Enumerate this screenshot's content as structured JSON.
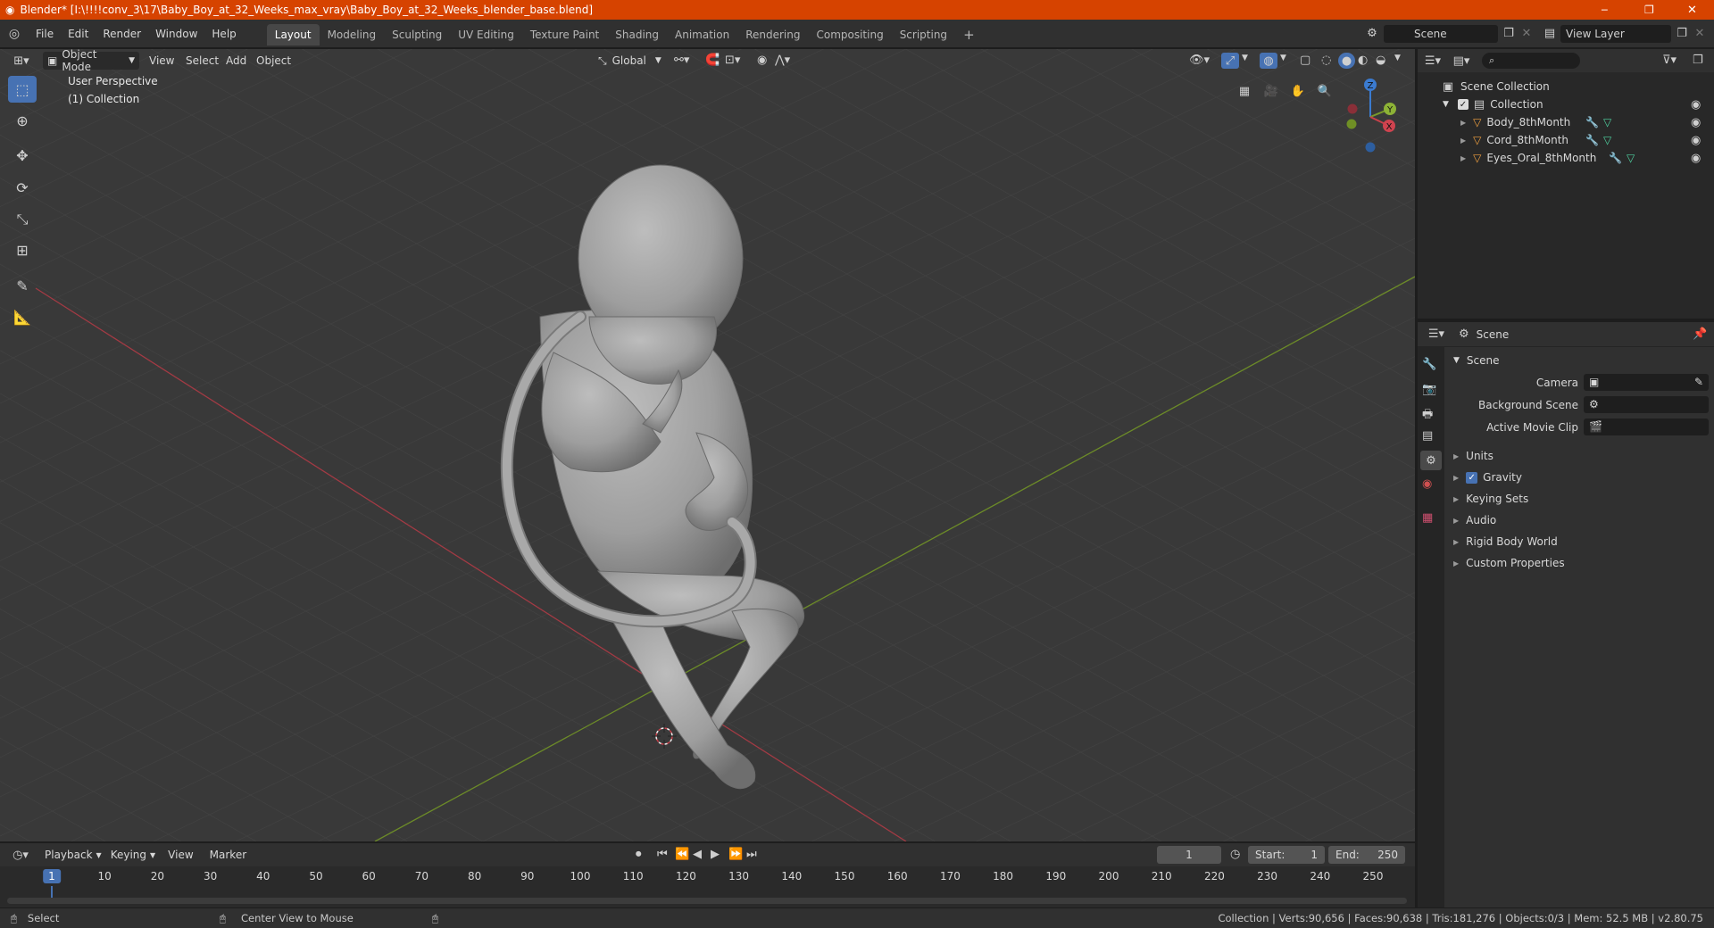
{
  "titlebar": {
    "title": "Blender* [I:\\!!!!conv_3\\17\\Baby_Boy_at_32_Weeks_max_vray\\Baby_Boy_at_32_Weeks_blender_base.blend]",
    "minimize": "─",
    "restore": "❐",
    "close": "✕"
  },
  "menus": [
    "File",
    "Edit",
    "Render",
    "Window",
    "Help"
  ],
  "workspaces": [
    "Layout",
    "Modeling",
    "Sculpting",
    "UV Editing",
    "Texture Paint",
    "Shading",
    "Animation",
    "Rendering",
    "Compositing",
    "Scripting"
  ],
  "workspace_add": "+",
  "scene_selector": "Scene",
  "view_layer": "View Layer",
  "viewport": {
    "mode": "Object Mode",
    "menu": [
      "View",
      "Select",
      "Add",
      "Object"
    ],
    "transform_orientation": "Global",
    "overlay_line1": "User Perspective",
    "overlay_line2": "(1) Collection",
    "gizmo": {
      "x": "X",
      "y": "Y",
      "z": "Z"
    }
  },
  "outliner": {
    "root": "Scene Collection",
    "collection": "Collection",
    "objects": [
      "Body_8thMonth",
      "Cord_8thMonth",
      "Eyes_Oral_8thMonth"
    ]
  },
  "properties": {
    "header": "Scene",
    "panel": "Scene",
    "fields": [
      {
        "label": "Camera"
      },
      {
        "label": "Background Scene"
      },
      {
        "label": "Active Movie Clip"
      }
    ],
    "sections": [
      "Units",
      "Gravity",
      "Keying Sets",
      "Audio",
      "Rigid Body World",
      "Custom Properties"
    ],
    "gravity_checked": true
  },
  "timeline": {
    "menu": [
      "Playback",
      "Keying",
      "View",
      "Marker"
    ],
    "current_frame": "1",
    "start_label": "Start:",
    "start": "1",
    "end_label": "End:",
    "end": "250",
    "ruler": [
      "1",
      "10",
      "20",
      "30",
      "40",
      "50",
      "60",
      "70",
      "80",
      "90",
      "100",
      "110",
      "120",
      "130",
      "140",
      "150",
      "160",
      "170",
      "180",
      "190",
      "200",
      "210",
      "220",
      "230",
      "240",
      "250"
    ]
  },
  "statusbar": {
    "left": "Select",
    "middle": "Center View to Mouse",
    "stats": "Collection | Verts:90,656 | Faces:90,638 | Tris:181,276 | Objects:0/3 | Mem: 52.5 MB | v2.80.75"
  },
  "colors": {
    "titlebar": "#d64300",
    "accent": "#4772b3",
    "viewport": "#393939",
    "xaxis": "#c8414b",
    "yaxis": "#7a9a2a"
  }
}
